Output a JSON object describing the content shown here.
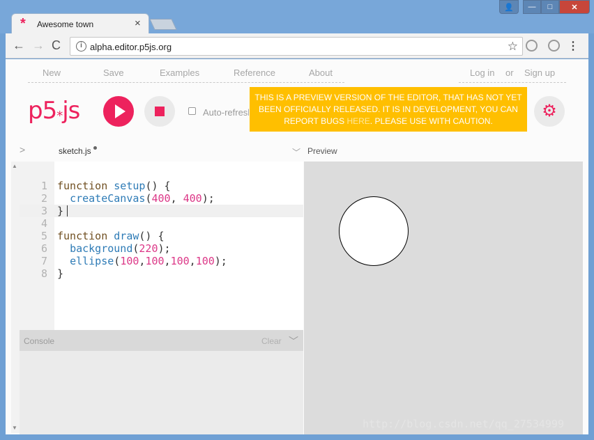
{
  "browser": {
    "tab_title": "Awesome town",
    "tab_close": "×",
    "url": "alpha.editor.p5js.org",
    "back": "←",
    "forward": "→",
    "reload": "C",
    "star": "☆",
    "menu": "⋮",
    "window_buttons": {
      "user": "👤",
      "minimize": "—",
      "maximize": "□",
      "close": "✕"
    }
  },
  "nav": {
    "new": "New",
    "save": "Save",
    "examples": "Examples",
    "reference": "Reference",
    "about": "About",
    "login": "Log in",
    "or": "or",
    "signup": "Sign up"
  },
  "toolbar": {
    "logo_p5": "p5",
    "logo_star": "*",
    "logo_js": "js",
    "auto_refresh": "Auto-refresh",
    "banner_text_1": "THIS IS A PREVIEW VERSION OF THE EDITOR, THAT HAS NOT YET BEEN OFFICIALLY RELEASED. IT IS IN DEVELOPMENT, YOU CAN REPORT BUGS ",
    "banner_link": "HERE",
    "banner_text_2": ". PLEASE USE WITH CAUTION.",
    "gear": "⚙"
  },
  "editor": {
    "filename": "sketch.js",
    "preview_label": "Preview",
    "lines": [
      "1",
      "2",
      "3",
      "4",
      "5",
      "6",
      "7",
      "8"
    ]
  },
  "console": {
    "title": "Console",
    "clear": "Clear"
  },
  "colors": {
    "accent": "#ed225d",
    "banner": "#ffbf00"
  },
  "watermark": "http://blog.csdn.net/qq_27534999"
}
